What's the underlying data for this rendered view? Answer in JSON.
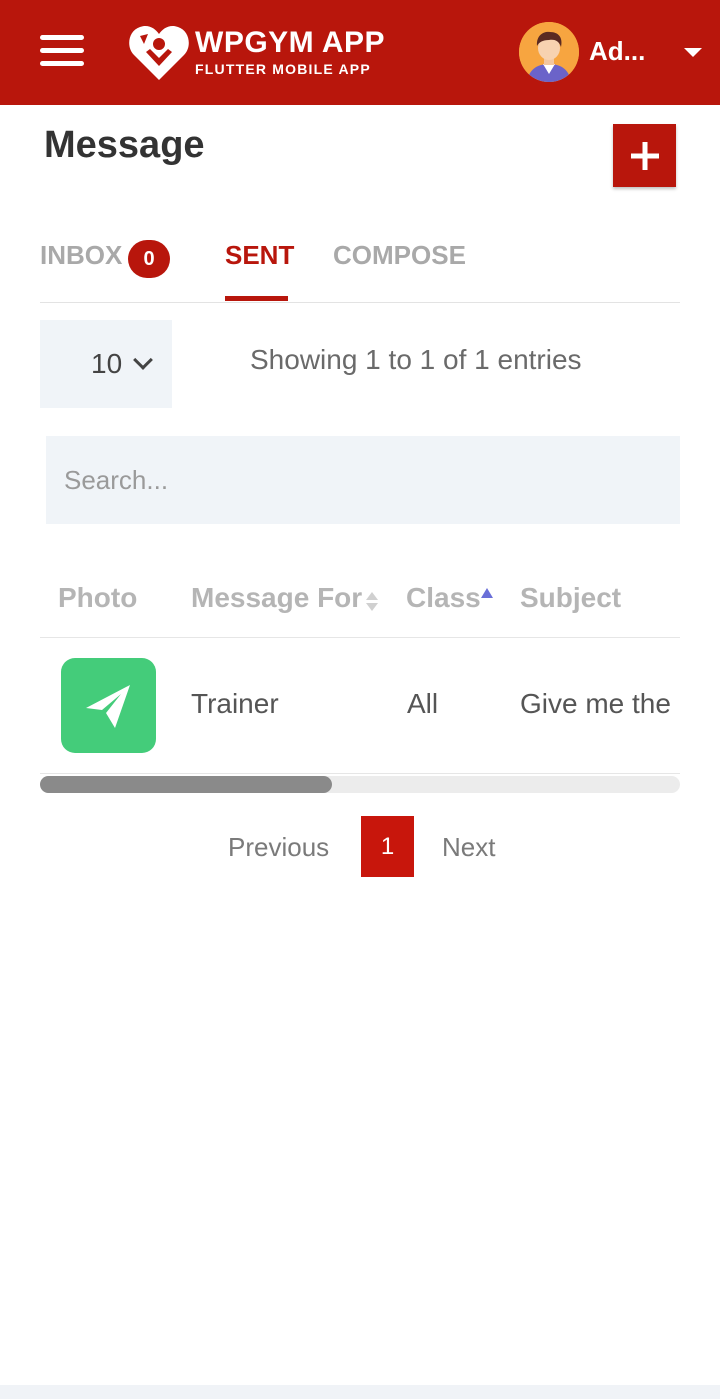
{
  "app": {
    "logo_title": "WPGYM APP",
    "logo_subtitle": "FLUTTER MOBILE APP",
    "user_name": "Ad...",
    "brand_color": "#b8160c"
  },
  "page": {
    "title": "Message"
  },
  "tabs": {
    "inbox_label": "INBOX",
    "inbox_count": "0",
    "sent_label": "SENT",
    "compose_label": "COMPOSE",
    "active": "SENT"
  },
  "table_controls": {
    "page_length": "10",
    "info": "Showing 1 to 1 of 1 entries",
    "search_placeholder": "Search..."
  },
  "table": {
    "columns": [
      "Photo",
      "Message For",
      "Class",
      "Subject"
    ],
    "rows": [
      {
        "photo_icon": "paper-plane-icon",
        "message_for": "Trainer",
        "class": "All",
        "subject": "Give me the"
      }
    ]
  },
  "pagination": {
    "previous": "Previous",
    "current_page": "1",
    "next": "Next"
  }
}
